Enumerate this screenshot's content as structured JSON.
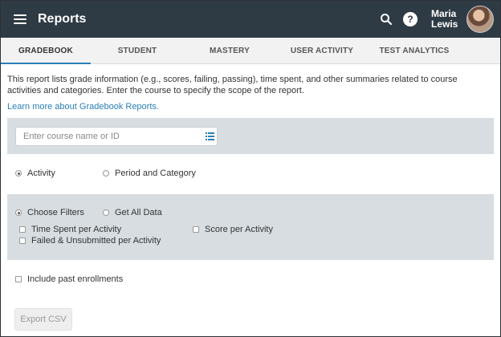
{
  "header": {
    "title": "Reports",
    "user_first": "Maria",
    "user_last": "Lewis",
    "help_glyph": "?"
  },
  "tabs": [
    {
      "label": "GRADEBOOK",
      "active": true
    },
    {
      "label": "STUDENT",
      "active": false
    },
    {
      "label": "MASTERY",
      "active": false
    },
    {
      "label": "USER ACTIVITY",
      "active": false
    },
    {
      "label": "TEST ANALYTICS",
      "active": false
    }
  ],
  "description": "This report lists grade information (e.g., scores, failing, passing), time spent, and other summaries related to course activities and categories. Enter the course to specify the scope of the report.",
  "learn_more": "Learn more about Gradebook Reports.",
  "course": {
    "placeholder": "Enter course name or ID",
    "value": ""
  },
  "grouping": {
    "activity": "Activity",
    "period_category": "Period and Category",
    "selected": "activity"
  },
  "filters": {
    "choose": "Choose Filters",
    "all": "Get All Data",
    "selected": "choose",
    "time_spent": "Time Spent per Activity",
    "score": "Score per Activity",
    "failed": "Failed & Unsubmitted per Activity"
  },
  "include_past": "Include past enrollments",
  "export": "Export CSV",
  "colors": {
    "topbar": "#2e3a44",
    "accent": "#2a7fb8",
    "panel": "#d7dde1"
  },
  "icons": [
    "menu-icon",
    "search-icon",
    "help-icon",
    "list-icon"
  ]
}
